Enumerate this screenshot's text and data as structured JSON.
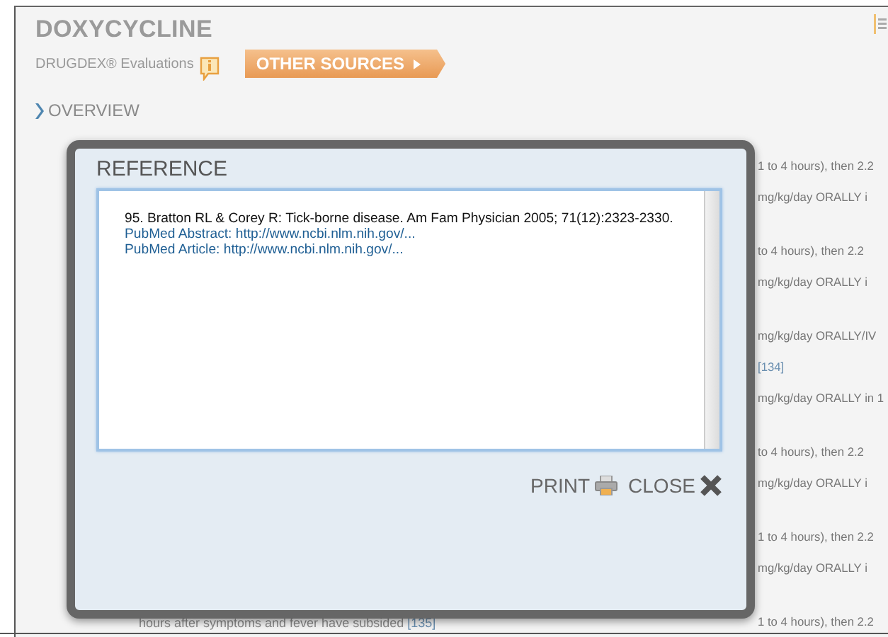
{
  "header": {
    "title": "DOXYCYCLINE",
    "subtitle": "DRUGDEX® Evaluations",
    "other_sources_button": "OTHER SOURCES"
  },
  "section": {
    "label": "OVERVIEW"
  },
  "background_text": {
    "groups": [
      [
        {
          "kind": "text",
          "text": "1 to 4 hours), then 2.2"
        },
        {
          "kind": "text",
          "text": "mg/kg/day ORALLY i"
        }
      ],
      [
        {
          "kind": "text",
          "text": "to 4 hours), then 2.2"
        },
        {
          "kind": "text",
          "text": "mg/kg/day ORALLY i"
        }
      ],
      [
        {
          "kind": "text",
          "text": "mg/kg/day ORALLY/IV"
        },
        {
          "kind": "ref",
          "text": "[134]"
        },
        {
          "kind": "text",
          "text": "mg/kg/day ORALLY in 1"
        }
      ],
      [
        {
          "kind": "text",
          "text": "to 4 hours), then 2.2"
        },
        {
          "kind": "text",
          "text": "mg/kg/day ORALLY i"
        }
      ],
      [
        {
          "kind": "text",
          "text": "1 to 4 hours), then 2.2"
        },
        {
          "kind": "text",
          "text": "mg/kg/day ORALLY i"
        }
      ],
      [
        {
          "kind": "text",
          "text": "1 to 4 hours), then 2.2"
        }
      ]
    ],
    "footer_line": "hours after symptoms and fever have subsided",
    "footer_ref": "[135]"
  },
  "dialog": {
    "title": "REFERENCE",
    "citation": "95. Bratton RL & Corey R: Tick-borne disease. Am Fam Physician 2005; 71(12):2323-2330.",
    "links": [
      "PubMed Abstract: http://www.ncbi.nlm.nih.gov/...",
      "PubMed Article: http://www.ncbi.nlm.nih.gov/..."
    ],
    "buttons": [
      {
        "label": "PRINT",
        "kind": "print"
      },
      {
        "label": "CLOSE",
        "kind": "close"
      }
    ]
  }
}
